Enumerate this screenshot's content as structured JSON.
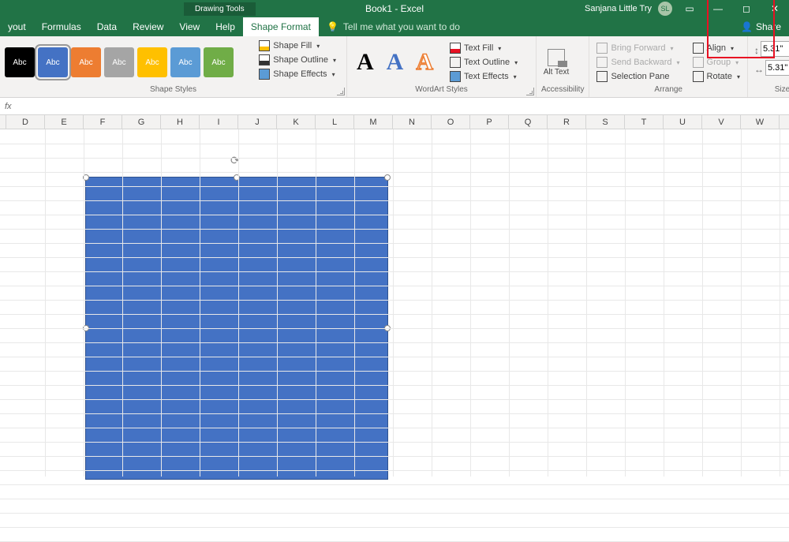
{
  "titlebar": {
    "contextual_tab": "Drawing Tools",
    "doc_title": "Book1 - Excel",
    "user_name": "Sanjana Little Try",
    "user_initials": "SL",
    "share": "Share"
  },
  "tabs": [
    "yout",
    "Formulas",
    "Data",
    "Review",
    "View",
    "Help",
    "Shape Format"
  ],
  "active_tab": "Shape Format",
  "tellme": "Tell me what you want to do",
  "ribbon": {
    "shape_styles": {
      "label": "Shape Styles",
      "swatches": [
        {
          "bg": "#000000",
          "txt": "Abc"
        },
        {
          "bg": "#4472c4",
          "txt": "Abc",
          "selected": true
        },
        {
          "bg": "#ed7d31",
          "txt": "Abc"
        },
        {
          "bg": "#a5a5a5",
          "txt": "Abc"
        },
        {
          "bg": "#ffc000",
          "txt": "Abc"
        },
        {
          "bg": "#5b9bd5",
          "txt": "Abc"
        },
        {
          "bg": "#70ad47",
          "txt": "Abc"
        }
      ],
      "fill": "Shape Fill",
      "outline": "Shape Outline",
      "effects": "Shape Effects"
    },
    "wordart": {
      "label": "WordArt Styles",
      "text_fill": "Text Fill",
      "text_outline": "Text Outline",
      "text_effects": "Text Effects"
    },
    "accessibility": {
      "label": "Accessibility",
      "alt": "Alt Text"
    },
    "arrange": {
      "label": "Arrange",
      "bring_forward": "Bring Forward",
      "send_backward": "Send Backward",
      "selection_pane": "Selection Pane",
      "align": "Align",
      "group": "Group",
      "rotate": "Rotate"
    },
    "size": {
      "label": "Size",
      "height": "5.31\"",
      "width": "5.31\""
    }
  },
  "formula_bar_fx": "fx",
  "columns": [
    "",
    "D",
    "E",
    "F",
    "G",
    "H",
    "I",
    "J",
    "K",
    "L",
    "M",
    "N",
    "O",
    "P",
    "Q",
    "R",
    "S",
    "T",
    "U",
    "V",
    "W"
  ]
}
